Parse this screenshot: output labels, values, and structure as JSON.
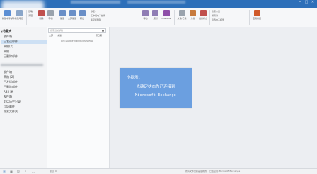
{
  "ribbon": {
    "buttons": [
      {
        "label": "新建电子邮件",
        "color": "#5c8fd4"
      },
      {
        "label": "新建项目",
        "color": "#8aa6c9"
      },
      {
        "label": "忽略",
        "color": "#9aa3ad"
      },
      {
        "label": "清理",
        "color": "#9aa3ad"
      },
      {
        "label": "删除",
        "color": "#c0504d"
      },
      {
        "label": "存档",
        "color": "#9aa3ad"
      },
      {
        "label": "答复",
        "color": "#6a8fc7"
      },
      {
        "label": "全部答复",
        "color": "#6a8fc7"
      },
      {
        "label": "转发",
        "color": "#6a8fc7"
      },
      {
        "label": "移动",
        "color": "#8f7db4"
      },
      {
        "label": "规则",
        "color": "#8f7db4"
      },
      {
        "label": "OneNote",
        "color": "#8e4fa8"
      },
      {
        "label": "未读/已读",
        "color": "#9aa3ad"
      },
      {
        "label": "分类",
        "color": "#c77b3e"
      },
      {
        "label": "后续标志",
        "color": "#c0504d"
      },
      {
        "label": "通讯簿",
        "color": "#7a8ea8"
      },
      {
        "label": "应用商店",
        "color": "#d05a2a"
      }
    ],
    "quick_steps": [
      "移至:?",
      "工作组电子邮件",
      "答复和删除"
    ],
    "find": [
      "搜索人员",
      "通讯簿",
      "筛选电子邮件"
    ],
    "groups": [
      "新建",
      "删除",
      "响应",
      "快速步骤",
      "移动",
      "标记",
      "查找",
      "加载项"
    ]
  },
  "folders": {
    "favorites_header": "收藏夹",
    "favorites": [
      "收件箱",
      "已发送邮件",
      "草稿(2)",
      "草稿",
      "已删除邮件"
    ],
    "account_items": [
      "收件箱",
      "草稿 [2]",
      "已发送邮件",
      "已删除邮件",
      "RSS 源",
      "发件箱",
      "对话历史记录",
      "垃圾邮件",
      "搜索文件夹"
    ],
    "selected_index": 1
  },
  "message_list": {
    "search_placeholder": "搜索当前邮箱",
    "filters": [
      "全部",
      "未读"
    ],
    "sort_label": "按日期",
    "empty_text": "我们没有在此视图中找到任何内容。"
  },
  "status_bar": {
    "left_text": "项目: 0",
    "right_text": "所有文件夹都是最新的。  已连接到: Microsoft Exchange"
  },
  "popup": {
    "title": "小提示：",
    "line1": "先确定状态为已连接到",
    "line2": "Microsoft Exchange"
  }
}
